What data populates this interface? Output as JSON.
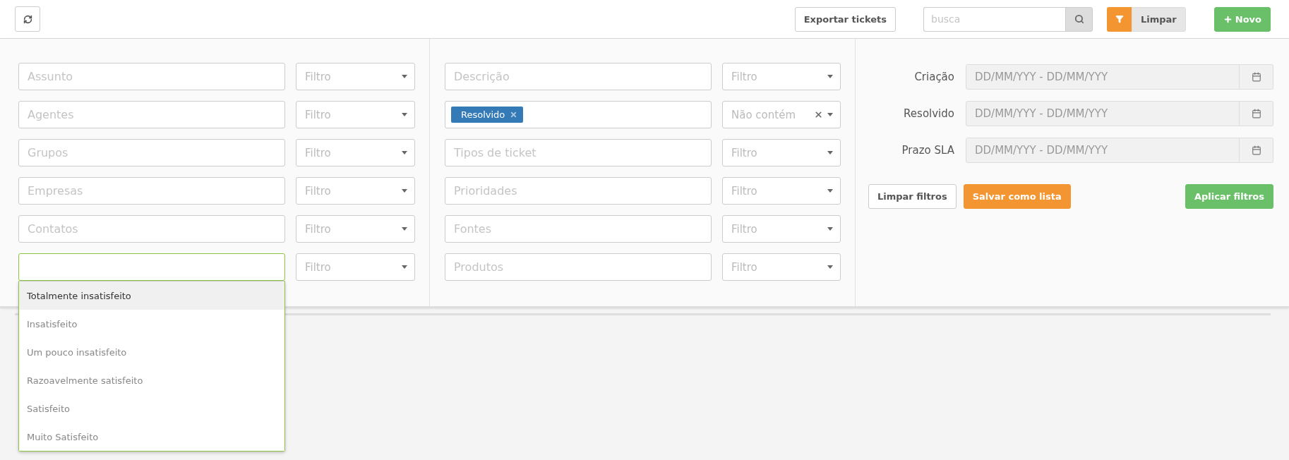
{
  "toolbar": {
    "export_button": "Exportar tickets",
    "search": {
      "placeholder": "busca"
    },
    "clear_button": "Limpar",
    "new_button": "Novo"
  },
  "filter_columns": [
    {
      "rows": [
        {
          "field": {
            "kind": "text",
            "placeholder": "Assunto"
          },
          "operator": {
            "placeholder": "Filtro"
          }
        },
        {
          "field": {
            "kind": "text",
            "placeholder": "Agentes"
          },
          "operator": {
            "placeholder": "Filtro"
          }
        },
        {
          "field": {
            "kind": "text",
            "placeholder": "Grupos"
          },
          "operator": {
            "placeholder": "Filtro"
          }
        },
        {
          "field": {
            "kind": "text",
            "placeholder": "Empresas"
          },
          "operator": {
            "placeholder": "Filtro"
          }
        },
        {
          "field": {
            "kind": "text",
            "placeholder": "Contatos"
          },
          "operator": {
            "placeholder": "Filtro"
          }
        },
        {
          "field": {
            "kind": "select",
            "focused": true,
            "options": [
              {
                "label": "Totalmente insatisfeito",
                "selected": true
              },
              {
                "label": "Insatisfeito",
                "selected": false
              },
              {
                "label": "Um pouco insatisfeito",
                "selected": false
              },
              {
                "label": "Razoavelmente satisfeito",
                "selected": false
              },
              {
                "label": "Satisfeito",
                "selected": false
              },
              {
                "label": "Muito Satisfeito",
                "selected": false
              }
            ]
          },
          "operator": {
            "placeholder": "Filtro"
          }
        }
      ]
    },
    {
      "rows": [
        {
          "field": {
            "kind": "text",
            "placeholder": "Descrição"
          },
          "operator": {
            "placeholder": "Filtro"
          }
        },
        {
          "field": {
            "kind": "tags",
            "tags": [
              "Resolvido"
            ]
          },
          "operator": {
            "value": "Não contém"
          }
        },
        {
          "field": {
            "kind": "text",
            "placeholder": "Tipos de ticket"
          },
          "operator": {
            "placeholder": "Filtro"
          }
        },
        {
          "field": {
            "kind": "text",
            "placeholder": "Prioridades"
          },
          "operator": {
            "placeholder": "Filtro"
          }
        },
        {
          "field": {
            "kind": "text",
            "placeholder": "Fontes"
          },
          "operator": {
            "placeholder": "Filtro"
          }
        },
        {
          "field": {
            "kind": "text",
            "placeholder": "Produtos"
          },
          "operator": {
            "placeholder": "Filtro"
          }
        }
      ]
    }
  ],
  "date_filters": [
    {
      "label": "Criação",
      "placeholder": "DD/MM/YYY - DD/MM/YYY"
    },
    {
      "label": "Resolvido",
      "placeholder": "DD/MM/YYY - DD/MM/YYY"
    },
    {
      "label": "Prazo SLA",
      "placeholder": "DD/MM/YYY - DD/MM/YYY"
    }
  ],
  "actions": {
    "clear": "Limpar filtros",
    "save": "Salvar como lista",
    "apply": "Aplicar filtros"
  }
}
